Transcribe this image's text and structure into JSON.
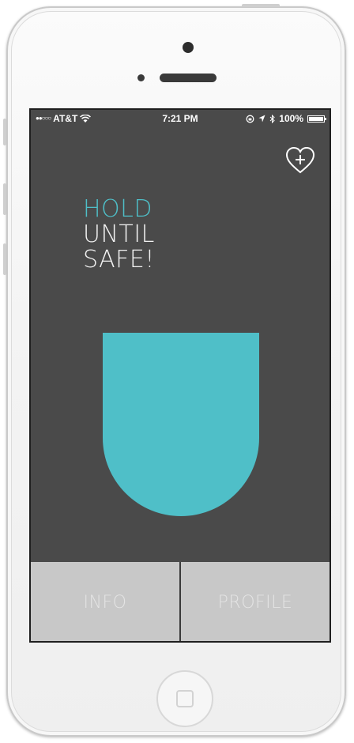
{
  "status_bar": {
    "signal": "●●○○○",
    "carrier": "AT&T",
    "wifi_icon": "wifi-icon",
    "time": "7:21 PM",
    "lock_icon": "rotation-lock-icon",
    "location_icon": "location-arrow-icon",
    "bluetooth_icon": "bluetooth-icon",
    "battery": "100%"
  },
  "header": {
    "favorite_icon": "heart-plus-icon"
  },
  "main": {
    "instruction_line1": "HOLD",
    "instruction_line2": "UNTIL",
    "instruction_line3": "SAFE!"
  },
  "tabs": [
    {
      "label": "INFO"
    },
    {
      "label": "PROFILE"
    }
  ],
  "colors": {
    "accent": "#4fbfc8",
    "screen_bg": "#4a4a4a",
    "tab_bg": "#c8c8c8"
  }
}
